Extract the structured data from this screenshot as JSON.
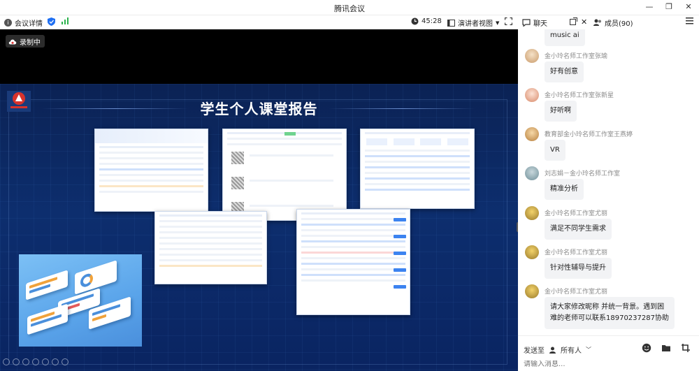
{
  "window": {
    "title": "腾讯会议"
  },
  "toolbar": {
    "meeting_info": "会议详情",
    "timer": "45:28",
    "view_mode": "演讲者视图"
  },
  "side_header": {
    "chat_tab": "聊天",
    "members_tab": "成员(90)"
  },
  "video": {
    "recording_label": "录制中",
    "slide_title": "学生个人课堂报告"
  },
  "chat": {
    "messages": [
      {
        "name": "",
        "text": "music ai"
      },
      {
        "name": "金小玲名师工作室张瑜",
        "text": "好有创意"
      },
      {
        "name": "金小玲名师工作室张新星",
        "text": "好听啊"
      },
      {
        "name": "教育部金小玲名师工作室王燕婷",
        "text": "VR"
      },
      {
        "name": "刘志娟－金小玲名师工作室",
        "text": "精准分析"
      },
      {
        "name": "金小玲名师工作室尤丽",
        "text": "满足不同学生需求"
      },
      {
        "name": "金小玲名师工作室尤丽",
        "text": "针对性辅导与提升"
      },
      {
        "name": "金小玲名师工作室尤丽",
        "text": "请大家修改昵称 并统一背景。遇到困",
        "text2": "难的老师可以联系18970237287协助"
      }
    ]
  },
  "send": {
    "send_to_label": "发送至",
    "recipient": "所有人",
    "input_placeholder": "请输入消息..."
  },
  "colors": {
    "accent": "#1f6ff2",
    "wifi": "#2bb24c",
    "slide_bg": "#0d2e6e"
  }
}
